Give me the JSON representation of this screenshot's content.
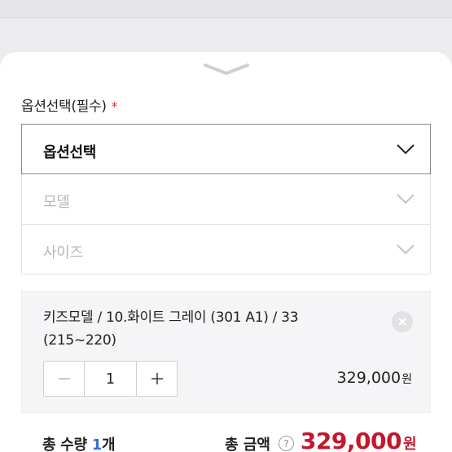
{
  "option_section": {
    "label": "옵션선택(필수)",
    "required_mark": "*"
  },
  "selects": {
    "main": "옵션선택",
    "model": "모델",
    "size": "사이즈"
  },
  "item": {
    "name": "키즈모델 / 10.화이트 그레이 (301 A1) / 33 (215~220)",
    "quantity": "1",
    "price": "329,000",
    "price_unit": "원"
  },
  "total": {
    "quantity_label": "총 수량",
    "quantity_count": "1",
    "quantity_unit": "개",
    "amount_label": "총 금액",
    "help": "?",
    "amount": "329,000",
    "amount_unit": "원"
  },
  "colors": {
    "required": "#e8283a",
    "count": "#2f73d9",
    "total_amount": "#c4172c"
  }
}
